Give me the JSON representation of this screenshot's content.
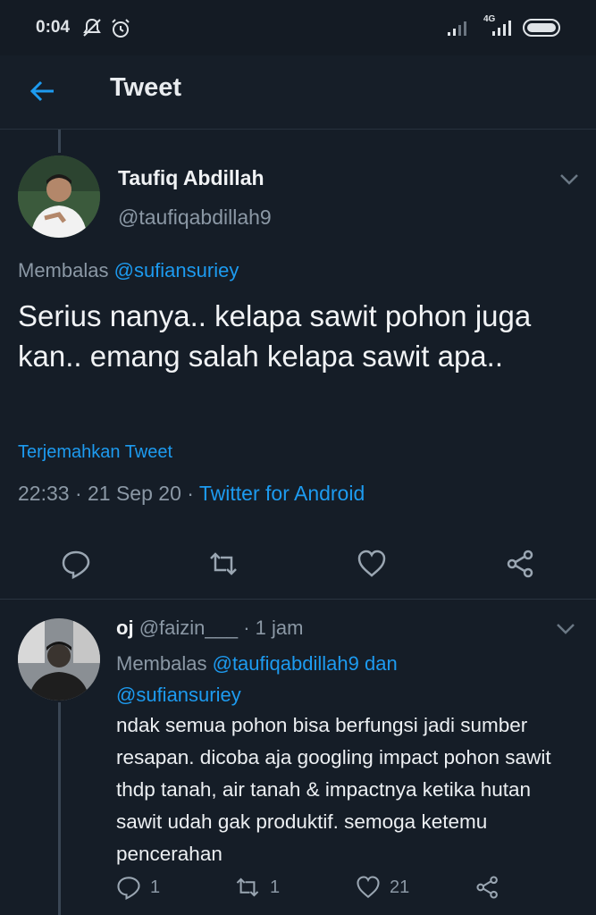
{
  "status_bar": {
    "time": "0:04",
    "network": "4G"
  },
  "app_bar": {
    "title": "Tweet"
  },
  "tweet": {
    "author_name": "Taufiq Abdillah",
    "author_handle": "@taufiqabdillah9",
    "replying_prefix": "Membalas",
    "replying_to": "@sufiansuriey",
    "text": "Serius nanya.. kelapa sawit pohon juga kan.. emang salah kelapa sawit apa..",
    "translate_label": "Terjemahkan Tweet",
    "timestamp": "22:33 · 21 Sep 20 · ",
    "source": "Twitter for Android"
  },
  "reply": {
    "author_name": "oj",
    "author_handle": "@faizin___",
    "time": " · 1 jam",
    "replying_prefix": "Membalas",
    "replying_to_1": "@taufiqabdillah9",
    "replying_joiner": "dan",
    "replying_to_2": "@sufiansuriey",
    "text": "ndak semua pohon bisa berfungsi jadi sumber resapan. dicoba aja googling impact pohon sawit thdp tanah, air tanah & impactnya ketika hutan sawit udah gak produktif. semoga ketemu pencerahan",
    "reply_count": "1",
    "retweet_count": "1",
    "like_count": "21"
  },
  "colors": {
    "background": "#151d27",
    "accent": "#1d9bf0",
    "muted": "#8b98a5"
  }
}
